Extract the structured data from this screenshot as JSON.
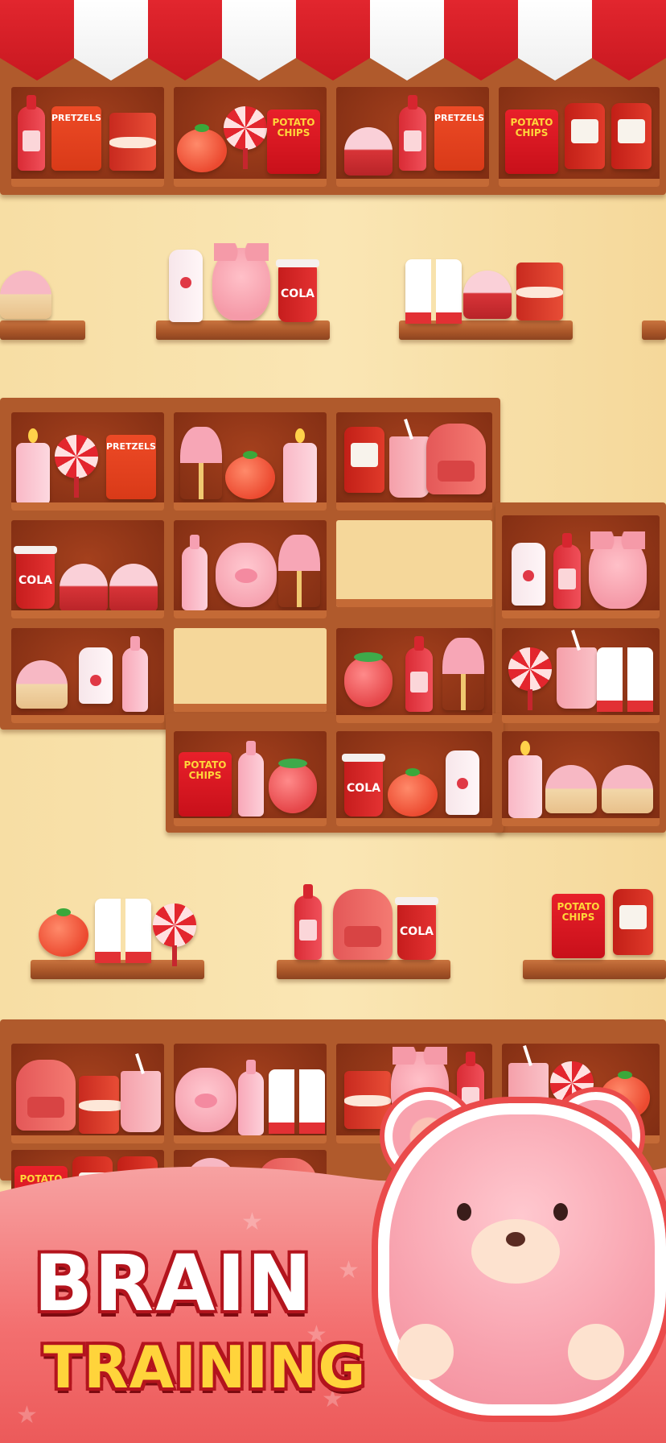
{
  "game": {
    "title_line1": "BRAIN",
    "title_line2": "TRAINING",
    "colors": {
      "awning_red": "#d92028",
      "awning_white": "#ffffff",
      "wall": "#f8e2aa",
      "shelf_wood": "#b05a2c",
      "banner": "#f36f6f",
      "title_white": "#ffffff",
      "title_yellow": "#ffd43b",
      "title_outline": "#b3141d"
    }
  },
  "labels": {
    "pretzels": "PRETZELS",
    "potato_chips": "POTATO CHIPS",
    "cola": "COLA"
  },
  "mascot": {
    "icon": "teddy-bear-icon"
  }
}
